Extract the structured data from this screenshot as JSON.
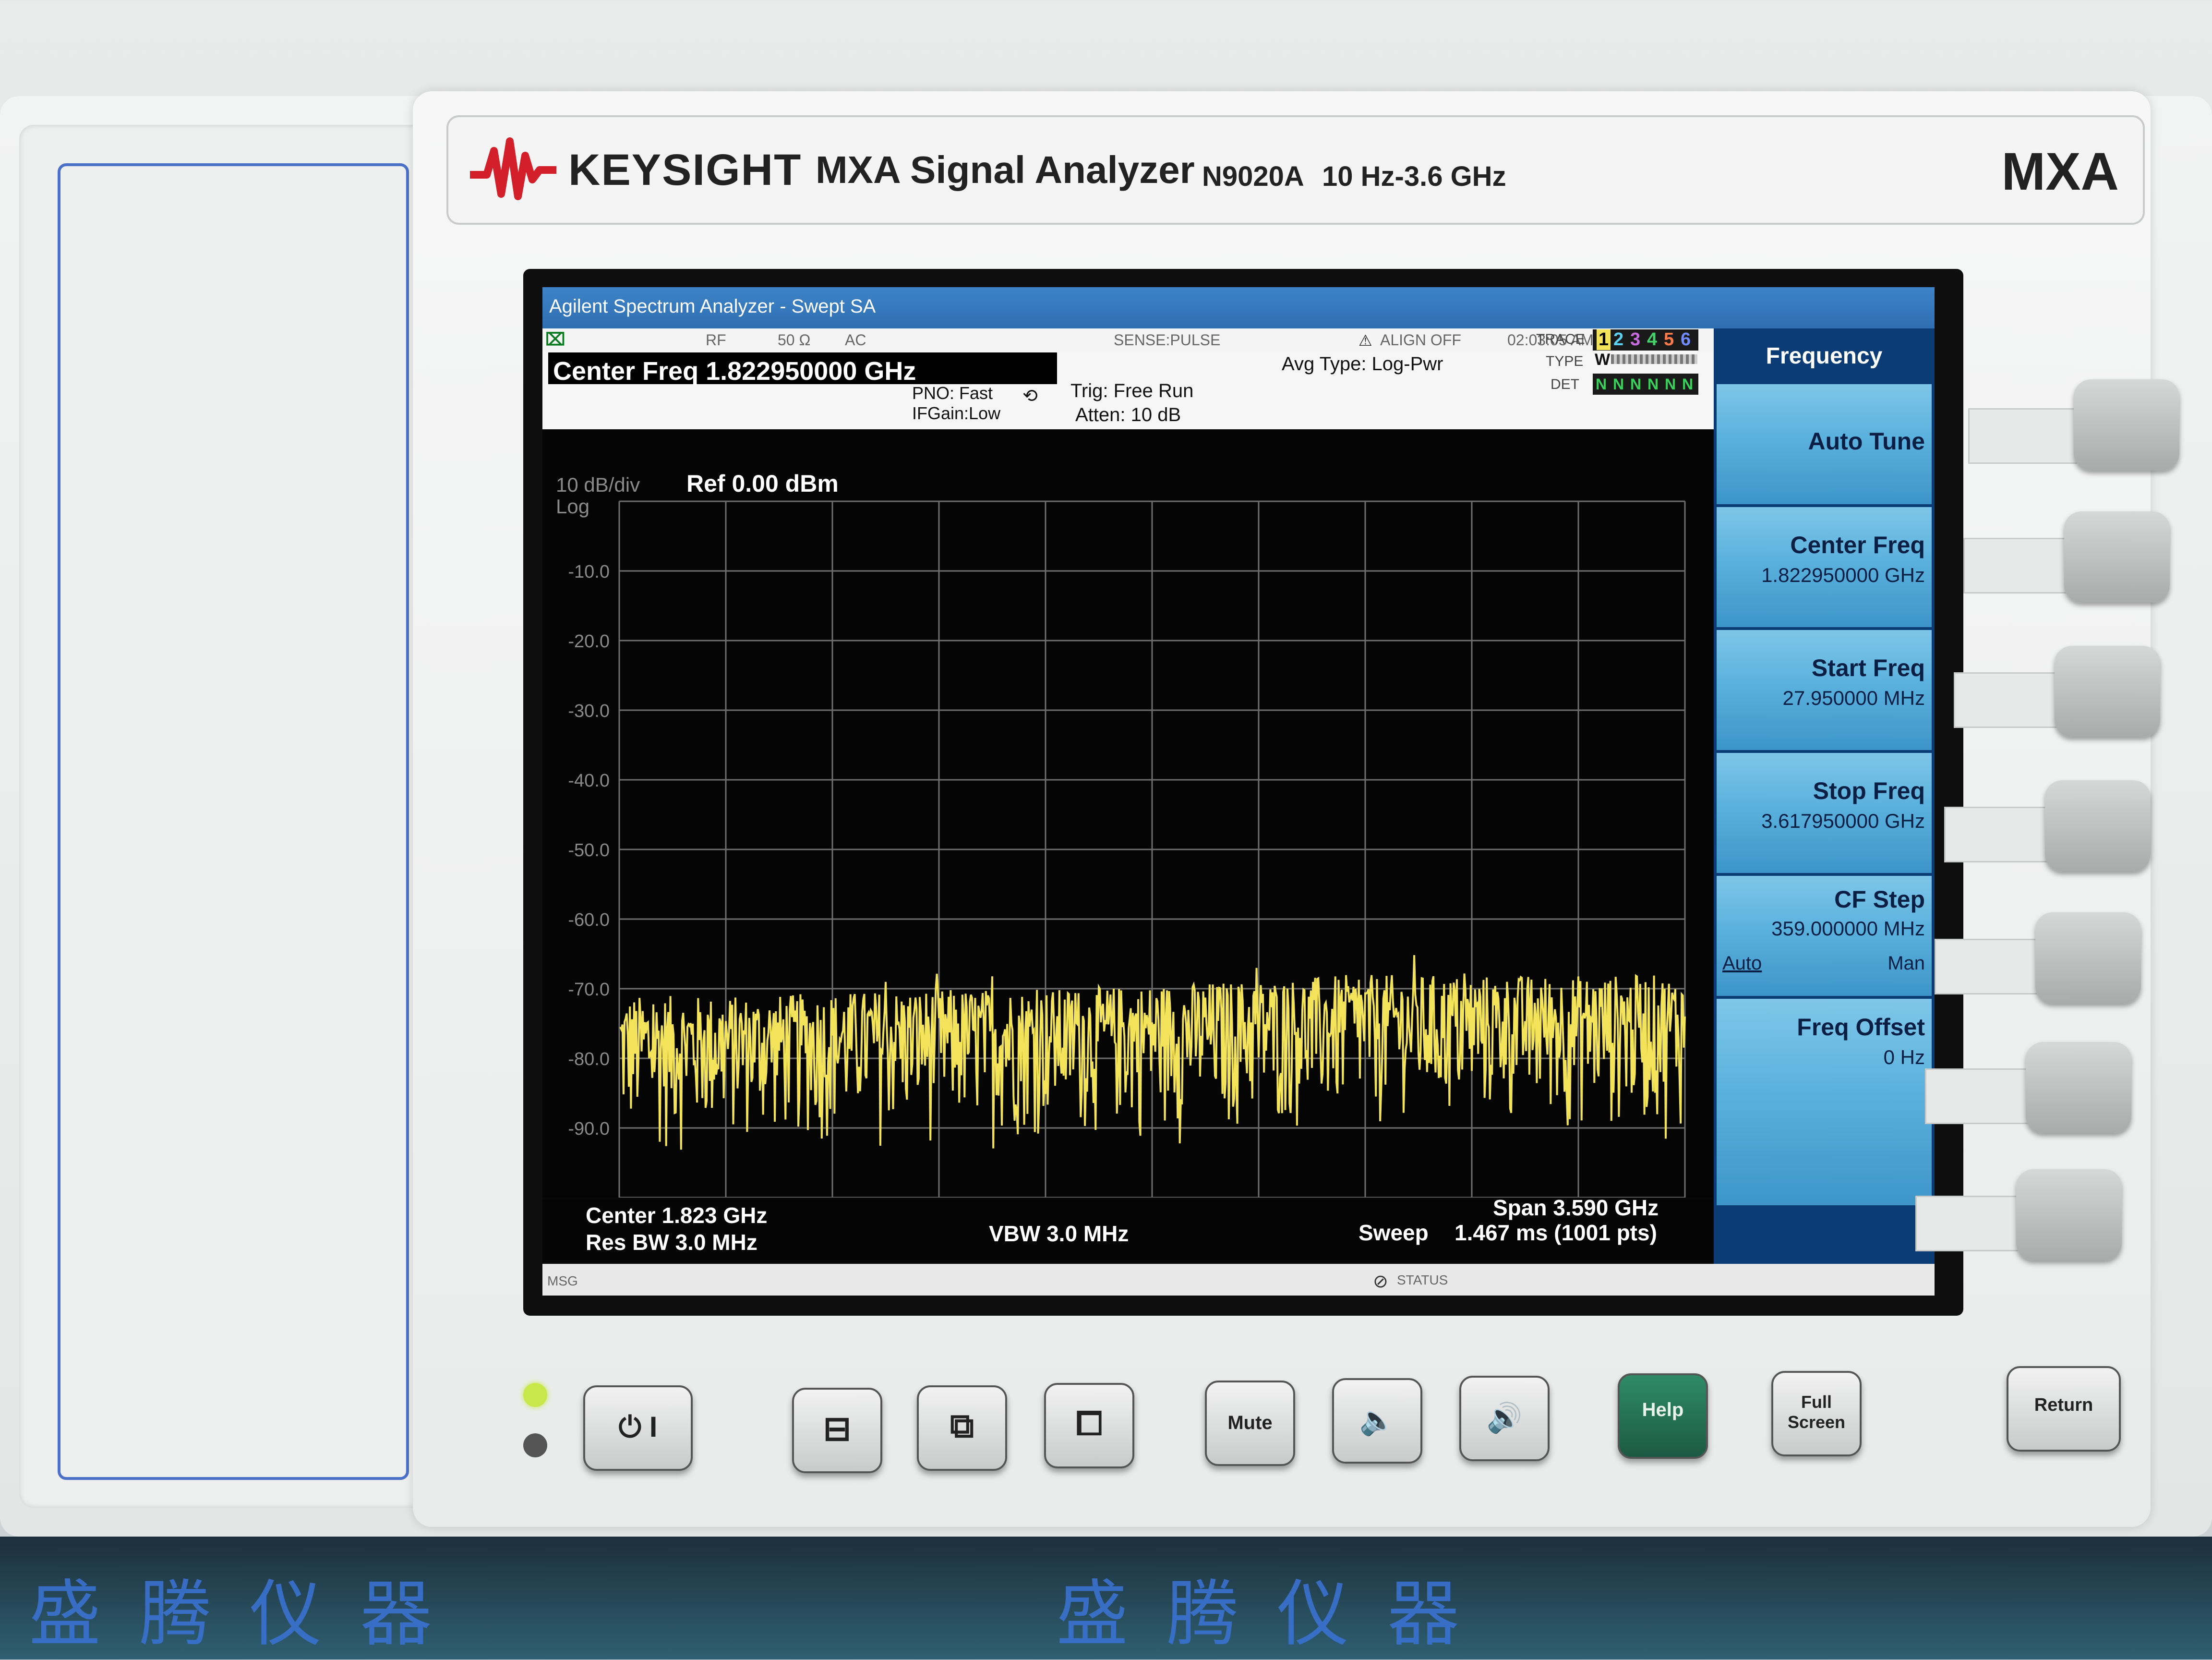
{
  "branding": {
    "brand": "KEYSIGHT",
    "product": "MXA Signal Analyzer",
    "model": "N9020A",
    "range": "10 Hz-3.6 GHz",
    "badge": "MXA"
  },
  "window": {
    "title": "Agilent Spectrum Analyzer - Swept SA"
  },
  "status_row": {
    "input": "RF",
    "impedance": "50 Ω",
    "coupling": "AC",
    "sense": "SENSE:PULSE",
    "align": "ALIGN OFF",
    "datetime": "02:03:05 AM Mar 12, 2020"
  },
  "settings": {
    "center_freq_label": "Center Freq 1.822950000 GHz",
    "pno": "PNO: Fast",
    "ifgain": "IFGain:Low",
    "trig": "Trig: Free Run",
    "atten": "Atten: 10 dB",
    "avg_type": "Avg Type: Log-Pwr"
  },
  "trace_panel": {
    "trace_label": "TRACE",
    "type_label": "TYPE",
    "det_label": "DET",
    "trace_numbers": [
      "1",
      "2",
      "3",
      "4",
      "5",
      "6"
    ],
    "trace_colors": [
      "#f2e35a",
      "#5ad1f0",
      "#c86be0",
      "#44d36a",
      "#ff7a4a",
      "#6e8bff"
    ],
    "type_value": "W",
    "det_values": "N N N N N N"
  },
  "softkey_menu": {
    "title": "Frequency",
    "keys": [
      {
        "label": "Auto Tune",
        "value": ""
      },
      {
        "label": "Center Freq",
        "value": "1.822950000 GHz"
      },
      {
        "label": "Start Freq",
        "value": "27.950000 MHz"
      },
      {
        "label": "Stop Freq",
        "value": "3.617950000 GHz"
      },
      {
        "label": "CF Step",
        "value": "359.000000 MHz",
        "option_a": "Auto",
        "option_b": "Man"
      },
      {
        "label": "Freq Offset",
        "value": "0 Hz"
      }
    ]
  },
  "plot": {
    "scale_per_div": "10 dB/div",
    "scale_type": "Log",
    "ref_level": "Ref 0.00 dBm",
    "y_tick_labels": [
      "-10.0",
      "-20.0",
      "-30.0",
      "-40.0",
      "-50.0",
      "-60.0",
      "-70.0",
      "-80.0",
      "-90.0"
    ]
  },
  "bottom_info": {
    "center": "Center 1.823 GHz",
    "res_bw": "Res BW 3.0 MHz",
    "vbw": "VBW 3.0 MHz",
    "span": "Span 3.590 GHz",
    "sweep_label": "Sweep",
    "sweep_value": "1.467 ms (1001 pts)"
  },
  "message_bar": {
    "msg_label": "MSG",
    "status_label": "STATUS"
  },
  "front_panel": {
    "mute_label": "Mute",
    "help_label": "Help",
    "full_screen_label": "Full Screen",
    "return_label": "Return"
  },
  "chart_data": {
    "type": "line",
    "title": "",
    "xlabel": "",
    "ylabel": "",
    "x_range_ghz": [
      0.02795,
      3.61795
    ],
    "ylim": [
      -100,
      0
    ],
    "grid": true,
    "series": [
      {
        "color": "#f2e35a",
        "description_points": [
          {
            "x_ghz": 0.03,
            "peak_dbm": -71,
            "floor_dbm": -97
          },
          {
            "x_ghz": 0.5,
            "peak_dbm": -71,
            "floor_dbm": -95
          },
          {
            "x_ghz": 1.0,
            "peak_dbm": -70,
            "floor_dbm": -95
          },
          {
            "x_ghz": 1.5,
            "peak_dbm": -70,
            "floor_dbm": -94
          },
          {
            "x_ghz": 2.0,
            "peak_dbm": -69,
            "floor_dbm": -94
          },
          {
            "x_ghz": 2.5,
            "peak_dbm": -68,
            "floor_dbm": -93
          },
          {
            "x_ghz": 3.0,
            "peak_dbm": -68,
            "floor_dbm": -93
          },
          {
            "x_ghz": 3.6,
            "peak_dbm": -68,
            "floor_dbm": -93
          }
        ]
      }
    ]
  }
}
